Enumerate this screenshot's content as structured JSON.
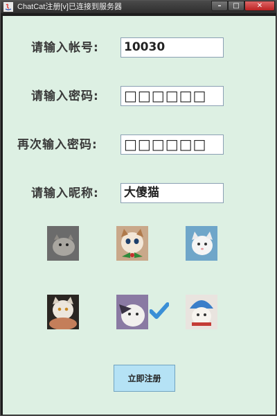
{
  "window": {
    "title": "ChatCat注册[v]已连接到服务器",
    "controls": {
      "minimize": "–",
      "maximize": "□",
      "close": "✕"
    }
  },
  "form": {
    "account_label": "请输入帐号:",
    "account_value": "10030",
    "password_label": "请输入密码:",
    "password_value": "□□□□□□",
    "confirm_label": "再次输入密码:",
    "confirm_value": "□□□□□□",
    "nickname_label": "请输入昵称:",
    "nickname_value": "大傻猫"
  },
  "avatars": [
    {
      "name": "grey-cat",
      "selected": false
    },
    {
      "name": "ginger-cat-bowtie",
      "selected": false
    },
    {
      "name": "white-cat-blue",
      "selected": false
    },
    {
      "name": "cat-in-hands",
      "selected": false
    },
    {
      "name": "purple-cat",
      "selected": true
    },
    {
      "name": "blue-hat-cat",
      "selected": false
    }
  ],
  "submit_label": "立即注册",
  "colors": {
    "background": "#ddf0e3",
    "button": "#b5e2f5",
    "check": "#3a8fd6"
  }
}
